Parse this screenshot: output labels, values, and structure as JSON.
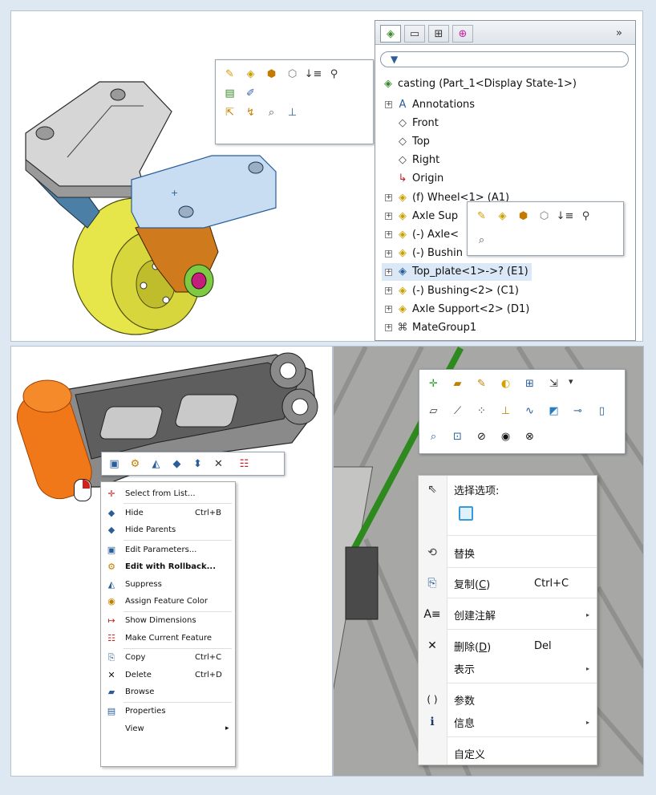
{
  "panel1": {
    "feature_tree": {
      "tabs": [
        "feature-manager-tab-icon",
        "property-manager-tab-icon",
        "configuration-manager-tab-icon",
        "dim-xpert-tab-icon"
      ],
      "more": "»",
      "root": "casting  (Part_1<Display State-1>)",
      "items": [
        {
          "label": "Annotations",
          "icon": "annotations-icon",
          "expand": "+"
        },
        {
          "label": "Front",
          "icon": "plane-icon",
          "expand": ""
        },
        {
          "label": "Top",
          "icon": "plane-icon",
          "expand": ""
        },
        {
          "label": "Right",
          "icon": "plane-icon",
          "expand": ""
        },
        {
          "label": "Origin",
          "icon": "origin-icon",
          "expand": ""
        },
        {
          "label": "(f) Wheel<1> (A1)",
          "icon": "part-icon",
          "expand": "+"
        },
        {
          "label": "Axle Sup",
          "icon": "part-icon",
          "expand": "+"
        },
        {
          "label": "(-) Axle<",
          "icon": "part-icon",
          "expand": "+"
        },
        {
          "label": "(-) Bushin",
          "icon": "part-icon",
          "expand": "+"
        },
        {
          "label": "Top_plate<1>->? (E1)",
          "icon": "part-icon",
          "expand": "+",
          "selected": true
        },
        {
          "label": "(-) Bushing<2> (C1)",
          "icon": "part-icon",
          "expand": "+"
        },
        {
          "label": "Axle Support<2> (D1)",
          "icon": "part-icon",
          "expand": "+"
        },
        {
          "label": "MateGroup1",
          "icon": "mates-icon",
          "expand": "+"
        }
      ]
    }
  },
  "panel3": {
    "context_menu": {
      "items": [
        {
          "label": "Select from List...",
          "icon": "select-icon"
        },
        {
          "label": "Hide",
          "shortcut": "Ctrl+B",
          "icon": "hide-icon"
        },
        {
          "label": "Hide Parents",
          "icon": "hide-parents-icon"
        },
        {
          "label": "Edit Parameters...",
          "icon": "edit-parameters-icon"
        },
        {
          "label": "Edit with Rollback...",
          "icon": "rollback-icon",
          "bold": true
        },
        {
          "label": "Suppress",
          "icon": "suppress-icon"
        },
        {
          "label": "Assign Feature Color",
          "icon": "color-icon"
        },
        {
          "label": "Show Dimensions",
          "icon": "dimensions-icon"
        },
        {
          "label": "Make Current Feature",
          "icon": "current-feature-icon"
        },
        {
          "label": "Copy",
          "shortcut": "Ctrl+C",
          "icon": "copy-icon"
        },
        {
          "label": "Delete",
          "shortcut": "Ctrl+D",
          "icon": "delete-icon"
        },
        {
          "label": "Browse",
          "icon": "browse-icon"
        },
        {
          "label": "Properties",
          "icon": "properties-icon"
        },
        {
          "label": "View",
          "icon": "",
          "submenu": "▸"
        }
      ]
    }
  },
  "panel4": {
    "toolbar": {
      "dropdown": "▾"
    },
    "context_menu": {
      "header": "选择选项:",
      "items": [
        {
          "label": "替换",
          "icon": "replace-icon"
        },
        {
          "label": "复制",
          "mnemonic": "C",
          "shortcut": "Ctrl+C",
          "icon": "copy-icon"
        },
        {
          "label": "创建注解",
          "icon": "annotation-icon",
          "submenu": "▸"
        },
        {
          "label": "删除",
          "mnemonic": "D",
          "shortcut": "Del",
          "icon": "delete-icon"
        },
        {
          "label": "表示",
          "icon": "",
          "submenu": "▸"
        },
        {
          "label": "参数",
          "icon": "parameters-icon"
        },
        {
          "label": "信息",
          "icon": "info-icon",
          "submenu": "▸"
        },
        {
          "label": "自定义",
          "icon": ""
        }
      ]
    }
  }
}
